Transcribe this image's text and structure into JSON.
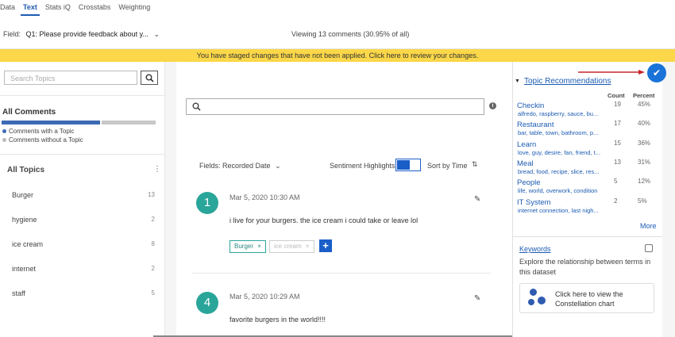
{
  "tabs": [
    "Data",
    "Text",
    "Stats iQ",
    "Crosstabs",
    "Weighting"
  ],
  "active_tab": "Text",
  "field": {
    "label": "Field:",
    "value": "Q1: Please provide feedback about y..."
  },
  "viewing": "Viewing 13 comments (30.95% of all)",
  "banner": "You have staged changes that have not been applied. Click here to review your changes.",
  "colors": {
    "banner": "#fbd749",
    "accent": "#1c5bb3",
    "teal": "#2aa59a",
    "button_blue": "#1a5ec8"
  },
  "left": {
    "search_placeholder": "Search Topics",
    "all_comments_title": "All Comments",
    "legend_with": "Comments with a Topic",
    "legend_without": "Comments without a Topic",
    "with_topic_fraction": 0.65,
    "all_topics_title": "All Topics",
    "topics": [
      {
        "name": "Burger",
        "count": "13"
      },
      {
        "name": "hygiene",
        "count": "2"
      },
      {
        "name": "ice cream",
        "count": "8"
      },
      {
        "name": "internet",
        "count": "2"
      },
      {
        "name": "staff",
        "count": "5"
      }
    ]
  },
  "center": {
    "fields_label": "Fields: Recorded Date",
    "sentiment_label": "Sentiment Highlights",
    "sort_label": "Sort by Time",
    "comments": [
      {
        "number": "1",
        "date": "Mar 5, 2020 10:30 AM",
        "text": "i live for your burgers. the ice cream i could take or leave lol",
        "tags": [
          {
            "label": "Burger",
            "applied": true
          },
          {
            "label": "ice cream",
            "applied": false
          }
        ]
      },
      {
        "number": "4",
        "date": "Mar 5, 2020 10:29 AM",
        "text": "favorite burgers in the world!!!!",
        "tags": []
      }
    ]
  },
  "right": {
    "recommendations_title": "Topic Recommendations",
    "col_count": "Count",
    "col_percent": "Percent",
    "recommendations": [
      {
        "name": "Checkin",
        "keywords": "alfredo, raspberry, sauce, bu...",
        "count": "19",
        "percent": "45%"
      },
      {
        "name": "Restaurant",
        "keywords": "bar, table, town, bathroom, p...",
        "count": "17",
        "percent": "40%"
      },
      {
        "name": "Learn",
        "keywords": "love, guy, desire, fan, friend, t...",
        "count": "15",
        "percent": "36%"
      },
      {
        "name": "Meal",
        "keywords": "bread, food, recipe, slice, res...",
        "count": "13",
        "percent": "31%"
      },
      {
        "name": "People",
        "keywords": "life, world, overwork, condition",
        "count": "5",
        "percent": "12%"
      },
      {
        "name": "IT System",
        "keywords": "internet connection, last nigh...",
        "count": "2",
        "percent": "5%"
      }
    ],
    "more": "More",
    "keywords_title": "Keywords",
    "keywords_desc": "Explore the relationship between terms in this dataset",
    "constellation_text": "Click here to view the Constellation chart"
  }
}
